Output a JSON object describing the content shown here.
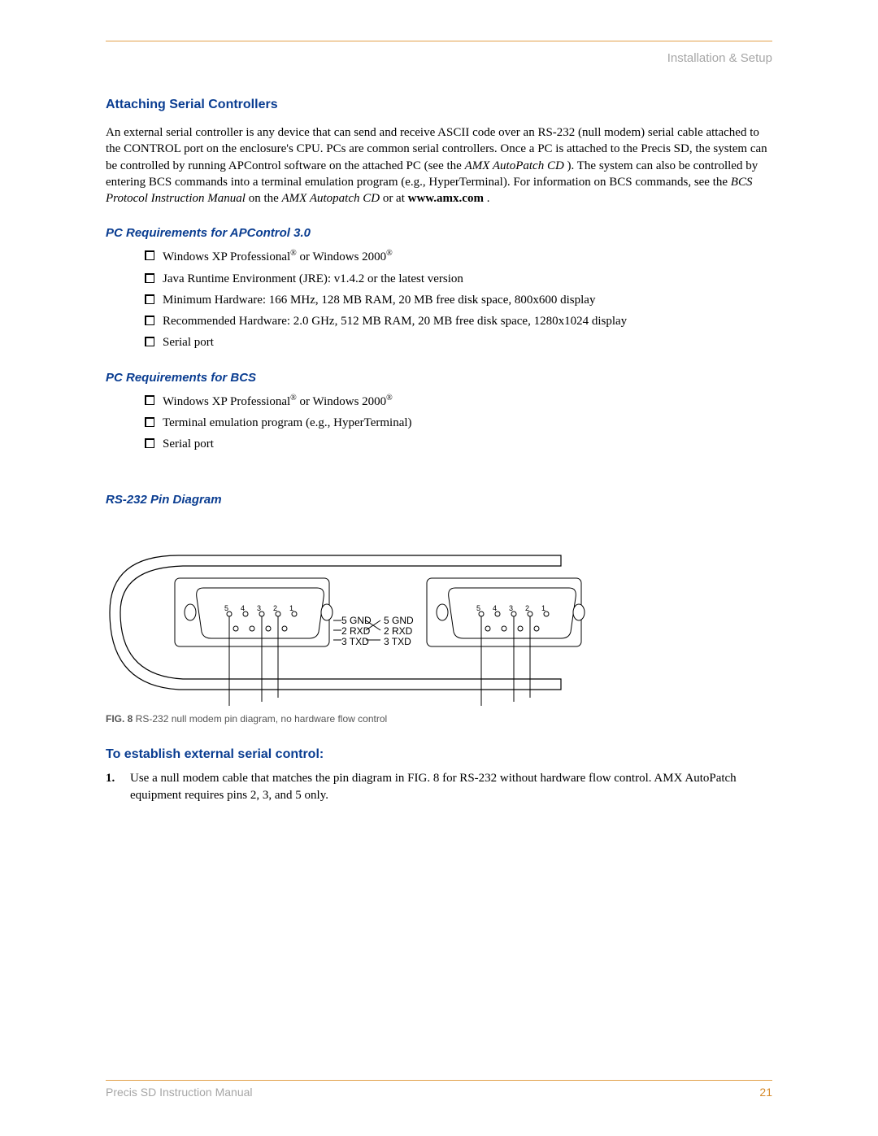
{
  "header": {
    "section": "Installation & Setup"
  },
  "h1": "Attaching Serial Controllers",
  "intro": {
    "p1a": "An external serial controller is any device that can send and receive ASCII code over an RS-232 (null modem) serial cable attached to the CONTROL port on the enclosure's CPU. PCs are common serial controllers. Once a PC is attached to the Precis SD, the system can be controlled by running APControl software on the attached PC (see the ",
    "em1": "AMX AutoPatch CD",
    "p1b": "). The system can also be controlled by entering BCS commands into a terminal emulation program (e.g., HyperTerminal). For information on BCS commands, see the ",
    "em2": "BCS Protocol Instruction Manual",
    "p1c": " on the ",
    "em3": "AMX Autopatch CD",
    "p1d": " or at ",
    "bold_url": "www.amx.com",
    "p1e": "."
  },
  "req_apcontrol": {
    "heading": "PC Requirements for APControl 3.0",
    "items": [
      {
        "pre": "Windows XP Professional",
        "reg": "®",
        "mid": " or Windows 2000",
        "reg2": "®"
      },
      {
        "text": "Java Runtime Environment (JRE): v1.4.2 or the latest version"
      },
      {
        "text": "Minimum Hardware: 166 MHz, 128 MB RAM, 20 MB free disk space, 800x600 display"
      },
      {
        "text": "Recommended Hardware: 2.0 GHz, 512 MB RAM, 20 MB free disk space, 1280x1024 display"
      },
      {
        "text": "Serial port"
      }
    ]
  },
  "req_bcs": {
    "heading": "PC Requirements for BCS",
    "items": [
      {
        "pre": "Windows XP Professional",
        "reg": "®",
        "mid": " or Windows 2000",
        "reg2": "®"
      },
      {
        "text": "Terminal emulation program (e.g., HyperTerminal)"
      },
      {
        "text": "Serial port"
      }
    ]
  },
  "diagram": {
    "heading": "RS-232 Pin Diagram",
    "pin_labels_left": [
      "5 GND",
      "2 RXD",
      "3 TXD"
    ],
    "pin_labels_right": [
      "5 GND",
      "2 RXD",
      "3 TXD"
    ],
    "pins": [
      "5",
      "4",
      "3",
      "2",
      "1"
    ],
    "caption_bold": "FIG. 8",
    "caption_rest": "  RS-232 null modem pin diagram, no hardware flow control"
  },
  "h2": "To establish external serial control:",
  "steps": [
    {
      "num": "1.",
      "text": "Use a null modem cable that matches the pin diagram in FIG. 8 for RS-232 without hardware flow control. AMX AutoPatch equipment requires pins 2, 3, and 5 only."
    }
  ],
  "footer": {
    "doc": "Precis SD Instruction Manual",
    "page": "21"
  }
}
